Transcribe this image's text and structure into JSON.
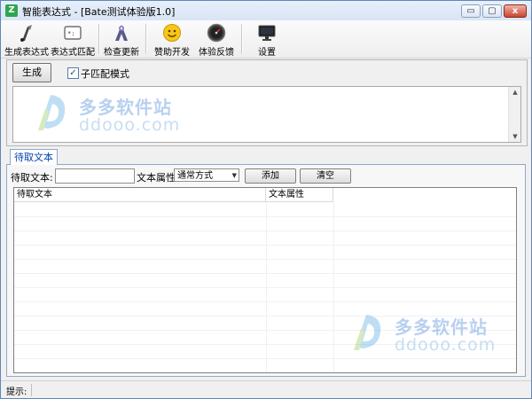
{
  "window": {
    "title": "智能表达式 - [Bate测试体验版1.0]",
    "app_icon": "Z",
    "controls": {
      "minimize": "▭",
      "maximize": "▢",
      "close": "x"
    }
  },
  "toolbar": {
    "items": [
      {
        "label": "生成表达式",
        "icon": "generate-expression-icon"
      },
      {
        "label": "表达式匹配",
        "icon": "match-expression-icon"
      },
      {
        "label": "检查更新",
        "icon": "check-update-icon"
      },
      {
        "label": "赞助开发",
        "icon": "smiley-sponsor-icon"
      },
      {
        "label": "体验反馈",
        "icon": "feedback-gauge-icon"
      },
      {
        "label": "设置",
        "icon": "monitor-settings-icon"
      }
    ]
  },
  "generate": {
    "button_label": "生成",
    "submatch_label": "子匹配模式",
    "submatch_checked": true,
    "output_value": ""
  },
  "tab": {
    "label": "待取文本",
    "text_label": "待取文本:",
    "text_value": "",
    "attr_label": "文本属性:",
    "attr_selected": "通常方式",
    "add_label": "添加",
    "clear_label": "清空",
    "columns": [
      "待取文本",
      "文本属性"
    ],
    "rows": []
  },
  "status": {
    "label": "提示:",
    "text": ""
  },
  "watermark": {
    "cn": "多多软件站",
    "en": "ddooo.com"
  },
  "colors": {
    "accent": "#3a7bd5",
    "tab_text": "#0645ad",
    "title_bg": "#dde8f5"
  }
}
